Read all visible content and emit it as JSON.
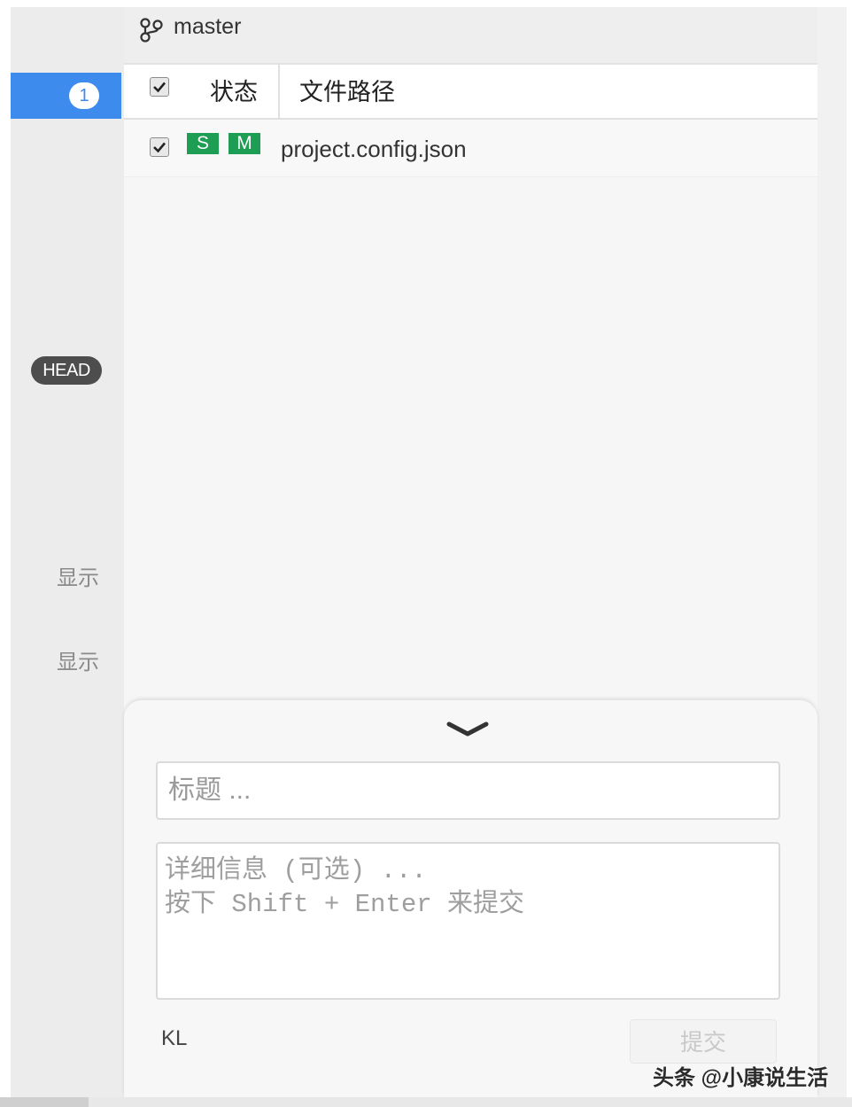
{
  "sidebar": {
    "changes_count": "1",
    "head_badge": "HEAD",
    "show_label_1": "显示",
    "show_label_2": "显示"
  },
  "branch": {
    "icon": "git-branch-icon",
    "name": "master"
  },
  "file_table": {
    "columns": [
      "状态",
      "文件路径"
    ],
    "header_checked": true,
    "rows": [
      {
        "checked": true,
        "tags": [
          "S",
          "M"
        ],
        "path": "project.config.json"
      }
    ]
  },
  "commit": {
    "collapse_icon": "chevron-down-icon",
    "title_placeholder": "标题 ...",
    "detail_placeholder_line1": "详细信息 (可选) ...",
    "detail_placeholder_line2": "按下 Shift + Enter 来提交",
    "author": "KL",
    "submit_label": "提交"
  },
  "watermark": "头条 @小康说生活",
  "colors": {
    "accent": "#3d8bec",
    "tag_green": "#1d9e54",
    "head_badge": "#4d4d4d"
  }
}
